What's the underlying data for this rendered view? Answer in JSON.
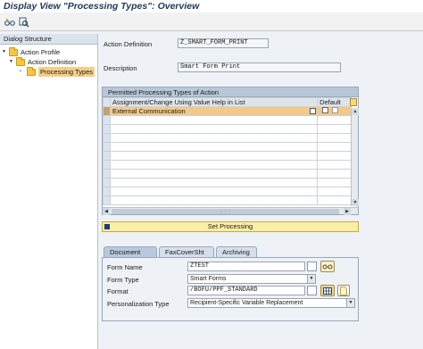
{
  "window": {
    "title": "Display View \"Processing Types\": Overview"
  },
  "toolbar": {
    "buttons": [
      "glasses-icon",
      "find-icon"
    ]
  },
  "tree": {
    "header": "Dialog Structure",
    "nodes": [
      {
        "label": "Action Profile",
        "level": 0
      },
      {
        "label": "Action Definition",
        "level": 1
      },
      {
        "label": "Processing Types",
        "level": 2,
        "selected": true
      }
    ]
  },
  "fields": {
    "action_definition_label": "Action Definition",
    "action_definition_value": "Z_SMART_FORM_PRINT",
    "description_label": "Description",
    "description_value": "Smart Form Print"
  },
  "grid": {
    "title": "Permitted Processing Types of Action",
    "columns": [
      "Assignment/Change Using Value Help in List",
      "Default"
    ],
    "rows": [
      {
        "value": "External Communication",
        "default": false,
        "active": true
      }
    ],
    "empty_rows": 10
  },
  "set_processing": {
    "label": "Set Processing"
  },
  "tabs": [
    "Document",
    "FaxCoverSht",
    "Archiving"
  ],
  "document": {
    "form_name_label": "Form Name",
    "form_name_value": "ZTEST",
    "form_type_label": "Form Type",
    "form_type_value": "Smart Forms",
    "format_label": "Format",
    "format_value": "/BOFU/PPF_STANDARD",
    "personalization_label": "Personalization Type",
    "personalization_value": "Recipient-Specific Variable Replacement"
  },
  "colors": {
    "title": "#203a5c",
    "selection": "#f3c98a",
    "button_yellow": "#fbeea5",
    "header_blue": "#b8c7d8"
  }
}
